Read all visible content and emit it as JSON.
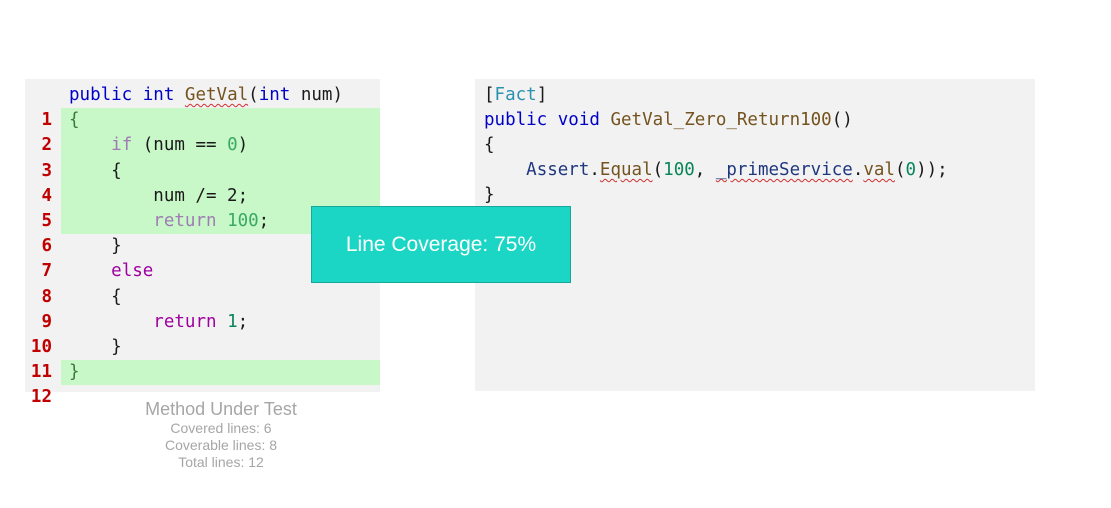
{
  "method_code": {
    "line_numbers": [
      "1",
      "2",
      "3",
      "4",
      "5",
      "6",
      "7",
      "8",
      "9",
      "10",
      "11",
      "12"
    ],
    "lines": {
      "l1": {
        "kw1": "public",
        "kw2": "int",
        "fn": "GetVal",
        "open": "(",
        "kw3": "int",
        "rest": " num)"
      },
      "l2": {
        "text": "{"
      },
      "l3": {
        "indent": "    ",
        "kw": "if",
        "mid": " (num == ",
        "num": "0",
        "close": ")"
      },
      "l4": {
        "text": "    {"
      },
      "l5": {
        "text": "        num /= 2;"
      },
      "l6": {
        "indent": "        ",
        "kw": "return",
        "sp": " ",
        "num": "100",
        "end": ";"
      },
      "l7": {
        "text": "    }"
      },
      "l8": {
        "indent": "    ",
        "kw": "else"
      },
      "l9": {
        "text": "    {"
      },
      "l10": {
        "indent": "        ",
        "kw": "return",
        "sp": " ",
        "num": "1",
        "end": ";"
      },
      "l11": {
        "text": "    }"
      },
      "l12": {
        "text": "}"
      }
    }
  },
  "test_code": {
    "r1": {
      "open": "[",
      "attr": "Fact",
      "close": "]"
    },
    "r2": {
      "kw1": "public",
      "kw2": "void",
      "fn": "GetVal_Zero_Return100",
      "end": "()"
    },
    "r3": {
      "text": "{"
    },
    "r4": {
      "indent": "    ",
      "cls": "Assert",
      "dot1": ".",
      "fn1": "Equal",
      "open": "(",
      "num1": "100",
      "comma": ", ",
      "field": "_primeService",
      "dot2": ".",
      "fn2": "val",
      "open2": "(",
      "num2": "0",
      "end": "));"
    },
    "r5": {
      "text": "}"
    }
  },
  "tooltip": {
    "text": "Line Coverage: 75%"
  },
  "caption": {
    "title": "Method Under Test",
    "covered": "Covered lines: 6",
    "coverable": "Coverable lines: 8",
    "total": "Total lines: 12"
  },
  "colors": {
    "covered_highlight": "#c8f7c8",
    "tooltip_bg": "#1bd5c5",
    "line_number": "#c00000",
    "keyword": "#0000c8",
    "control": "#a000a0",
    "method": "#74531f",
    "number": "#098658"
  }
}
